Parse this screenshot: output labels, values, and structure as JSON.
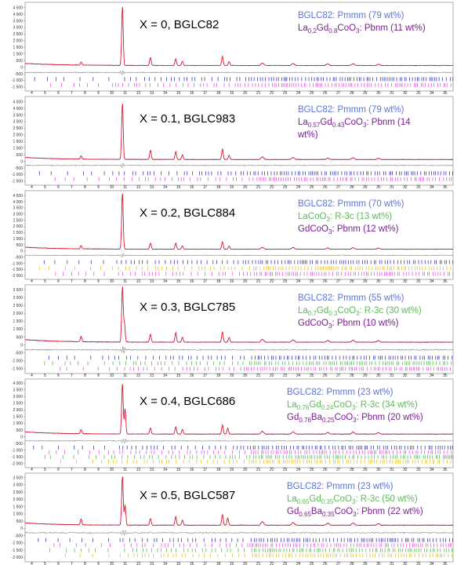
{
  "chart_data": [
    {
      "type": "line",
      "title": "X = 0, BGLC82",
      "legend": [
        {
          "text": "BGLC82: Pmmm (79 wt%)",
          "color": "#5b74d6",
          "parts": [
            {
              "t": "BGLC82: Pmmm (79 wt%)"
            }
          ]
        },
        {
          "text": "La0.2Gd0.8CoO3: Pbnm (11 wt%)",
          "color": "#7a1f8f",
          "parts": [
            {
              "t": "La"
            },
            {
              "t": "0.2",
              "sub": true
            },
            {
              "t": "Gd"
            },
            {
              "t": "0.8",
              "sub": true
            },
            {
              "t": "CoO"
            },
            {
              "t": "3",
              "sub": true
            },
            {
              "t": ": Pbnm (11 wt%)"
            }
          ]
        }
      ],
      "y_ticks": [
        "4 500",
        "4 000",
        "3 500",
        "3 000",
        "2 500",
        "2 000",
        "1 500",
        "1 000",
        "500",
        "0",
        "-500",
        "-1 000",
        "-1 500"
      ],
      "ylim": [
        -1800,
        4900
      ],
      "x_ticks": [
        "4",
        "5",
        "6",
        "7",
        "8",
        "9",
        "10",
        "11",
        "12",
        "13",
        "14",
        "15",
        "16",
        "17",
        "18",
        "19",
        "20",
        "21",
        "22",
        "23",
        "24",
        "25",
        "26",
        "27",
        "28",
        "29",
        "30",
        "31",
        "32",
        "33",
        "34",
        "35"
      ],
      "xlim": [
        3.5,
        35.6
      ],
      "peaks": [
        {
          "x": 7.7,
          "y": 230
        },
        {
          "x": 10.8,
          "y": 4500
        },
        {
          "x": 12.9,
          "y": 600
        },
        {
          "x": 14.8,
          "y": 500
        },
        {
          "x": 15.3,
          "y": 320
        },
        {
          "x": 18.3,
          "y": 700
        },
        {
          "x": 18.8,
          "y": 300
        },
        {
          "x": 21.3,
          "y": 180
        },
        {
          "x": 23.6,
          "y": 150
        },
        {
          "x": 26.2,
          "y": 110
        },
        {
          "x": 28.1,
          "y": 130
        },
        {
          "x": 30.0,
          "y": 90
        }
      ],
      "background": 130,
      "diff_offset": -400,
      "tick_rows": [
        {
          "y": -900,
          "color": "#3b3fb6"
        },
        {
          "y": -1350,
          "color": "#e060d8"
        }
      ]
    },
    {
      "type": "line",
      "title": "X = 0.1, BGLC983",
      "legend": [
        {
          "text": "BGLC82: Pmmm (79 wt%)",
          "color": "#5b74d6",
          "parts": [
            {
              "t": "BGLC82: Pmmm (79 wt%)"
            }
          ]
        },
        {
          "text": "La0.57Gd0.43CoO3: Pbnm (14",
          "color": "#7a1f8f",
          "parts": [
            {
              "t": "La"
            },
            {
              "t": "0.57",
              "sub": true
            },
            {
              "t": "Gd"
            },
            {
              "t": "0.43",
              "sub": true
            },
            {
              "t": "CoO"
            },
            {
              "t": "3",
              "sub": true
            },
            {
              "t": ": Pbnm (14"
            }
          ]
        },
        {
          "text": "wt%)",
          "color": "#7a1f8f",
          "parts": [
            {
              "t": "wt%)"
            }
          ]
        }
      ],
      "y_ticks": [
        "4 500",
        "4 000",
        "3 500",
        "3 000",
        "2 500",
        "2 000",
        "1 500",
        "1 000",
        "500",
        "0",
        "-500",
        "-1 000",
        "-1 500"
      ],
      "ylim": [
        -1800,
        4900
      ],
      "x_ticks": [
        "4",
        "5",
        "6",
        "7",
        "8",
        "9",
        "10",
        "11",
        "12",
        "13",
        "14",
        "15",
        "16",
        "17",
        "18",
        "19",
        "20",
        "21",
        "22",
        "23",
        "24",
        "25",
        "26",
        "27",
        "28",
        "29",
        "30",
        "31",
        "32",
        "33",
        "34",
        "35"
      ],
      "xlim": [
        3.5,
        35.6
      ],
      "peaks": [
        {
          "x": 7.7,
          "y": 250
        },
        {
          "x": 10.8,
          "y": 4300
        },
        {
          "x": 12.9,
          "y": 700
        },
        {
          "x": 14.8,
          "y": 600
        },
        {
          "x": 15.3,
          "y": 350
        },
        {
          "x": 18.3,
          "y": 800
        },
        {
          "x": 18.8,
          "y": 320
        },
        {
          "x": 21.3,
          "y": 200
        },
        {
          "x": 23.6,
          "y": 160
        },
        {
          "x": 26.2,
          "y": 110
        },
        {
          "x": 28.1,
          "y": 140
        },
        {
          "x": 30.0,
          "y": 90
        }
      ],
      "background": 140,
      "diff_offset": -300,
      "tick_rows": [
        {
          "y": -900,
          "color": "#3b3fb6"
        },
        {
          "y": -1350,
          "color": "#e060d8"
        }
      ]
    },
    {
      "type": "line",
      "title": "X = 0.2, BGLC884",
      "legend": [
        {
          "text": "BGLC82: Pmmm (70 wt%)",
          "color": "#5b74d6",
          "parts": [
            {
              "t": "BGLC82: Pmmm (70 wt%)"
            }
          ]
        },
        {
          "text": "LaCoO3: R-3c (13 wt%)",
          "color": "#5fb85b",
          "parts": [
            {
              "t": "LaCoO"
            },
            {
              "t": "3",
              "sub": true
            },
            {
              "t": ": R-3c (13 wt%)"
            }
          ]
        },
        {
          "text": "GdCoO3: Pbnm (12 wt%)",
          "color": "#7a1f8f",
          "parts": [
            {
              "t": "GdCoO"
            },
            {
              "t": "3",
              "sub": true
            },
            {
              "t": ": Pbnm (12 wt%)"
            }
          ]
        }
      ],
      "y_ticks": [
        "4 500",
        "4 000",
        "3 500",
        "3 000",
        "2 500",
        "2 000",
        "1 500",
        "1 000",
        "500",
        "0",
        "-500",
        "-1 000",
        "-1 500",
        "-2 000"
      ],
      "ylim": [
        -2300,
        4900
      ],
      "x_ticks": [
        "4",
        "5",
        "6",
        "7",
        "8",
        "9",
        "10",
        "11",
        "12",
        "13",
        "14",
        "15",
        "16",
        "17",
        "18",
        "19",
        "20",
        "21",
        "22",
        "23",
        "24",
        "25",
        "26",
        "27",
        "28",
        "29",
        "30",
        "31",
        "32",
        "33",
        "34",
        "35"
      ],
      "xlim": [
        3.5,
        35.6
      ],
      "peaks": [
        {
          "x": 7.7,
          "y": 250
        },
        {
          "x": 10.8,
          "y": 4600
        },
        {
          "x": 12.9,
          "y": 500
        },
        {
          "x": 14.8,
          "y": 500
        },
        {
          "x": 15.3,
          "y": 280
        },
        {
          "x": 18.3,
          "y": 600
        },
        {
          "x": 18.8,
          "y": 260
        },
        {
          "x": 21.3,
          "y": 150
        },
        {
          "x": 23.6,
          "y": 130
        },
        {
          "x": 26.2,
          "y": 100
        },
        {
          "x": 28.1,
          "y": 120
        },
        {
          "x": 30.0,
          "y": 80
        }
      ],
      "background": 150,
      "diff_offset": -350,
      "tick_rows": [
        {
          "y": -900,
          "color": "#3b3fb6"
        },
        {
          "y": -1400,
          "color": "#e6c229"
        },
        {
          "y": -1850,
          "color": "#e060d8"
        }
      ]
    },
    {
      "type": "line",
      "title": "X = 0.3, BGLC785",
      "legend": [
        {
          "text": "BGLC82: Pmmm (55 wt%)",
          "color": "#5b74d6",
          "parts": [
            {
              "t": "BGLC82: Pmmm (55 wt%)"
            }
          ]
        },
        {
          "text": "La0.7Gd0.3CoO3: R-3c (30 wt%)",
          "color": "#5fb85b",
          "parts": [
            {
              "t": "La"
            },
            {
              "t": "0.7",
              "sub": true
            },
            {
              "t": "Gd"
            },
            {
              "t": "0.3",
              "sub": true
            },
            {
              "t": "CoO"
            },
            {
              "t": "3",
              "sub": true
            },
            {
              "t": ": R-3c (30 wt%)"
            }
          ]
        },
        {
          "text": "GdCoO3: Pbnm (10 wt%)",
          "color": "#7a1f8f",
          "parts": [
            {
              "t": "GdCoO"
            },
            {
              "t": "3",
              "sub": true
            },
            {
              "t": ": Pbnm (10 wt%)"
            }
          ]
        }
      ],
      "y_ticks": [
        "3 500",
        "3 000",
        "2 500",
        "2 000",
        "1 500",
        "1 000",
        "500",
        "0",
        "-500",
        "-1 000",
        "-1 500"
      ],
      "ylim": [
        -1800,
        3800
      ],
      "x_ticks": [
        "4",
        "5",
        "6",
        "7",
        "8",
        "9",
        "10",
        "11",
        "12",
        "13",
        "14",
        "15",
        "16",
        "17",
        "18",
        "19",
        "20",
        "21",
        "22",
        "23",
        "24",
        "25",
        "26",
        "27",
        "28",
        "29",
        "30",
        "31",
        "32",
        "33",
        "34",
        "35"
      ],
      "xlim": [
        3.5,
        35.6
      ],
      "peaks": [
        {
          "x": 7.7,
          "y": 350
        },
        {
          "x": 10.8,
          "y": 3500
        },
        {
          "x": 10.95,
          "y": 1200
        },
        {
          "x": 12.9,
          "y": 500
        },
        {
          "x": 14.8,
          "y": 600
        },
        {
          "x": 15.3,
          "y": 300
        },
        {
          "x": 18.3,
          "y": 650
        },
        {
          "x": 18.8,
          "y": 300
        },
        {
          "x": 21.3,
          "y": 180
        },
        {
          "x": 23.6,
          "y": 140
        },
        {
          "x": 26.2,
          "y": 110
        },
        {
          "x": 28.1,
          "y": 120
        },
        {
          "x": 30.0,
          "y": 90
        }
      ],
      "background": 180,
      "diff_offset": -300,
      "tick_rows": [
        {
          "y": -800,
          "color": "#3b3fb6"
        },
        {
          "y": -1150,
          "color": "#5fb85b"
        },
        {
          "y": -1500,
          "color": "#e060d8"
        }
      ]
    },
    {
      "type": "line",
      "title": "X = 0.4, BGLC686",
      "legend": [
        {
          "text": "BGLC82: Pmmm (23 wt%)",
          "color": "#5b74d6",
          "parts": [
            {
              "t": "BGLC82: Pmmm (23 wt%)"
            }
          ]
        },
        {
          "text": "La0.76Gd0.24CoO3: R-3c (34 wt%)",
          "color": "#5fb85b",
          "parts": [
            {
              "t": "La"
            },
            {
              "t": "0.76",
              "sub": true
            },
            {
              "t": "Gd"
            },
            {
              "t": "0.24",
              "sub": true
            },
            {
              "t": "CoO"
            },
            {
              "t": "3",
              "sub": true
            },
            {
              "t": ": R-3c (34 wt%)"
            }
          ]
        },
        {
          "text": "Gd0.76Ba0.25CoO3: Pbnm (20 wt%)",
          "color": "#7a1f8f",
          "parts": [
            {
              "t": "Gd"
            },
            {
              "t": "0.76",
              "sub": true
            },
            {
              "t": "Ba"
            },
            {
              "t": "0.25",
              "sub": true
            },
            {
              "t": "CoO"
            },
            {
              "t": "3",
              "sub": true
            },
            {
              "t": ": Pbnm (20 wt%)"
            }
          ]
        }
      ],
      "y_ticks": [
        "4 000",
        "3 500",
        "3 000",
        "2 500",
        "2 000",
        "1 500",
        "1 000",
        "500",
        "0",
        "-500",
        "-1 000",
        "-1 500",
        "-2 000"
      ],
      "ylim": [
        -2300,
        4300
      ],
      "x_ticks": [
        "4",
        "5",
        "6",
        "7",
        "8",
        "9",
        "10",
        "11",
        "12",
        "13",
        "14",
        "15",
        "16",
        "17",
        "18",
        "19",
        "20",
        "21",
        "22",
        "23",
        "24",
        "25",
        "26",
        "27",
        "28",
        "29",
        "30",
        "31",
        "32",
        "33",
        "34",
        "35"
      ],
      "xlim": [
        3.5,
        35.6
      ],
      "peaks": [
        {
          "x": 7.7,
          "y": 300
        },
        {
          "x": 10.8,
          "y": 3800
        },
        {
          "x": 11.0,
          "y": 1900
        },
        {
          "x": 12.9,
          "y": 450
        },
        {
          "x": 14.8,
          "y": 550
        },
        {
          "x": 15.3,
          "y": 350
        },
        {
          "x": 18.3,
          "y": 700
        },
        {
          "x": 18.7,
          "y": 450
        },
        {
          "x": 21.3,
          "y": 200
        },
        {
          "x": 23.6,
          "y": 160
        },
        {
          "x": 26.2,
          "y": 120
        },
        {
          "x": 28.1,
          "y": 150
        },
        {
          "x": 30.0,
          "y": 100
        }
      ],
      "background": 200,
      "diff_offset": -300,
      "tick_rows": [
        {
          "y": -800,
          "color": "#3b3fb6"
        },
        {
          "y": -1150,
          "color": "#e060d8"
        },
        {
          "y": -1500,
          "color": "#5fb85b"
        },
        {
          "y": -1850,
          "color": "#e6c229"
        }
      ]
    },
    {
      "type": "line",
      "title": "X = 0.5, BGLC587",
      "legend": [
        {
          "text": "BGLC82: Pmmm (23 wt%)",
          "color": "#5b74d6",
          "parts": [
            {
              "t": "BGLC82: Pmmm (23 wt%)"
            }
          ]
        },
        {
          "text": "La0.65Gd0.35CoO3: R-3c (50 wt%)",
          "color": "#5fb85b",
          "parts": [
            {
              "t": "La"
            },
            {
              "t": "0.65",
              "sub": true
            },
            {
              "t": "Gd"
            },
            {
              "t": "0.35",
              "sub": true
            },
            {
              "t": "CoO"
            },
            {
              "t": "3",
              "sub": true
            },
            {
              "t": ": R-3c (50 wt%)"
            }
          ]
        },
        {
          "text": "Gd0.65Ba0.35CoO3: Pbnm (22 wt%)",
          "color": "#7a1f8f",
          "parts": [
            {
              "t": "Gd"
            },
            {
              "t": "0.65",
              "sub": true
            },
            {
              "t": "Ba"
            },
            {
              "t": "0.35",
              "sub": true
            },
            {
              "t": "CoO"
            },
            {
              "t": "3",
              "sub": true
            },
            {
              "t": ": Pbnm (22 wt%)"
            }
          ]
        }
      ],
      "y_ticks": [
        "3 500",
        "3 000",
        "2 500",
        "2 000",
        "1 500",
        "1 000",
        "500",
        "0",
        "-500",
        "-1 000",
        "-1 500",
        "-2 000"
      ],
      "ylim": [
        -2300,
        3800
      ],
      "x_ticks": [
        "4",
        "5",
        "6",
        "7",
        "8",
        "9",
        "10",
        "11",
        "12",
        "13",
        "14",
        "15",
        "16",
        "17",
        "18",
        "19",
        "20",
        "21",
        "22",
        "23",
        "24",
        "25",
        "26",
        "27",
        "28",
        "29",
        "30",
        "31",
        "32",
        "33",
        "34",
        "35"
      ],
      "xlim": [
        3.5,
        35.6
      ],
      "peaks": [
        {
          "x": 7.7,
          "y": 400
        },
        {
          "x": 10.8,
          "y": 3400
        },
        {
          "x": 11.0,
          "y": 1400
        },
        {
          "x": 12.9,
          "y": 450
        },
        {
          "x": 14.8,
          "y": 600
        },
        {
          "x": 15.3,
          "y": 350
        },
        {
          "x": 18.3,
          "y": 750
        },
        {
          "x": 18.7,
          "y": 500
        },
        {
          "x": 21.3,
          "y": 250
        },
        {
          "x": 23.6,
          "y": 180
        },
        {
          "x": 26.2,
          "y": 140
        },
        {
          "x": 28.1,
          "y": 160
        },
        {
          "x": 30.0,
          "y": 110
        }
      ],
      "background": 220,
      "diff_offset": -300,
      "tick_rows": [
        {
          "y": -800,
          "color": "#3b3fb6"
        },
        {
          "y": -1150,
          "color": "#e060d8"
        },
        {
          "y": -1500,
          "color": "#5fb85b"
        },
        {
          "y": -1850,
          "color": "#e6c229"
        }
      ]
    }
  ]
}
